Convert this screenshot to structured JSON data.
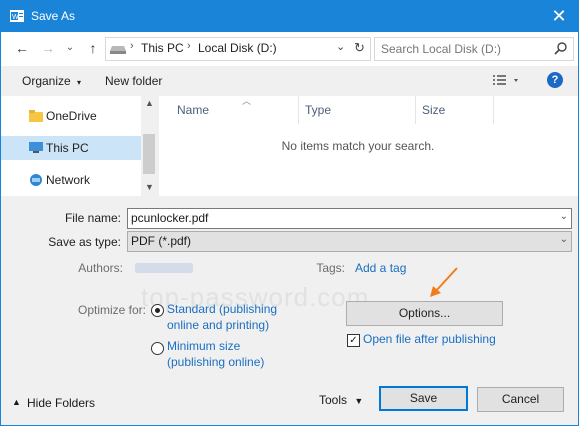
{
  "window": {
    "title": "Save As"
  },
  "address": {
    "crumbs": [
      "This PC",
      "Local Disk (D:)"
    ]
  },
  "search": {
    "placeholder": "Search Local Disk (D:)"
  },
  "toolbar": {
    "organize": "Organize",
    "new_folder": "New folder"
  },
  "nav_pane": {
    "items": [
      {
        "label": "OneDrive",
        "icon": "folder-icon"
      },
      {
        "label": "This PC",
        "icon": "computer-icon",
        "selected": true
      },
      {
        "label": "Network",
        "icon": "network-icon"
      }
    ]
  },
  "file_list": {
    "columns": [
      "Name",
      "Type",
      "Size"
    ],
    "empty_message": "No items match your search."
  },
  "form": {
    "file_name_label": "File name:",
    "file_name_value": "pcunlocker.pdf",
    "save_as_type_label": "Save as type:",
    "save_as_type_value": "PDF (*.pdf)",
    "authors_label": "Authors:",
    "tags_label": "Tags:",
    "add_tag": "Add a tag",
    "optimize_label": "Optimize for:",
    "opt_standard_line1": "Standard (publishing",
    "opt_standard_line2": "online and printing)",
    "opt_minimum_line1": "Minimum size",
    "opt_minimum_line2": "(publishing online)",
    "options_button": "Options...",
    "open_after_label": "Open file after publishing",
    "open_after_checked": true,
    "standard_selected": true
  },
  "footer": {
    "hide_folders": "Hide Folders",
    "tools": "Tools",
    "save": "Save",
    "cancel": "Cancel"
  },
  "watermark": "top-password.com",
  "colors": {
    "accent": "#1a84d8",
    "link": "#1a6fc2",
    "arrow": "#f07d1a"
  }
}
